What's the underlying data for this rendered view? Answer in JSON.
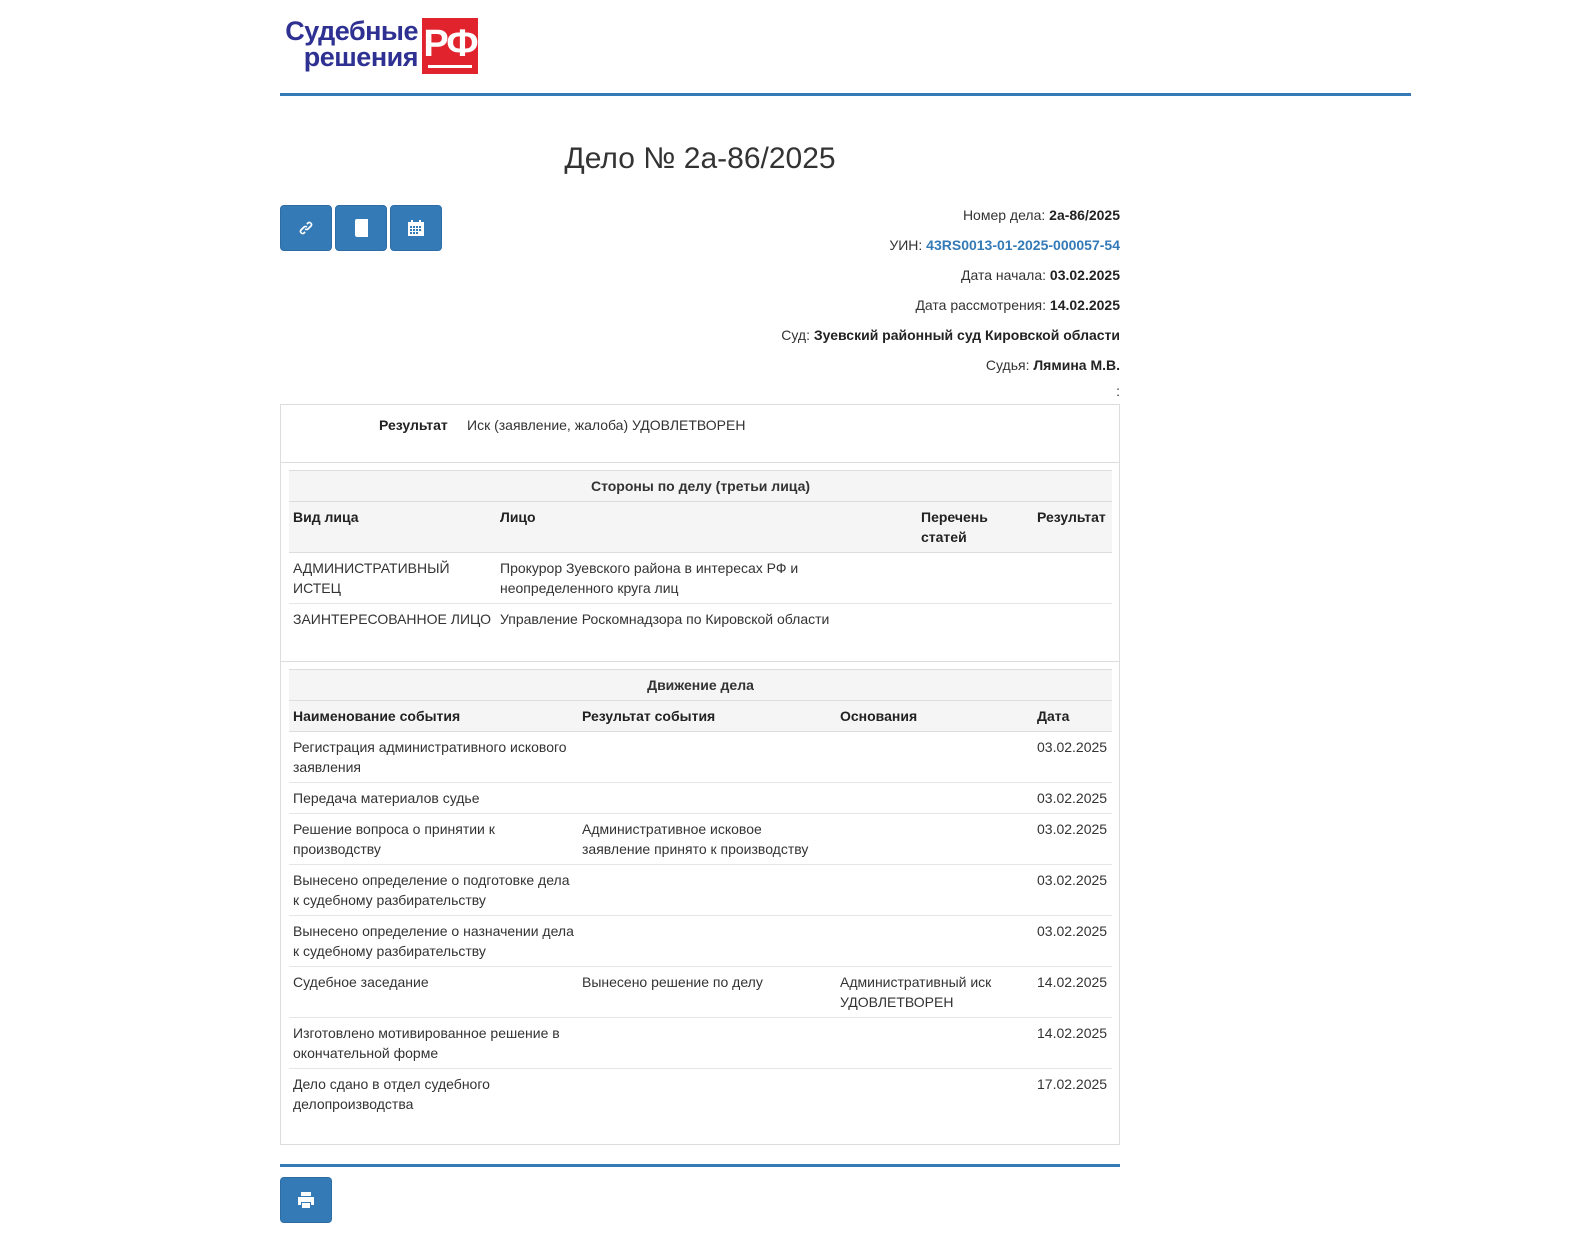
{
  "logo": {
    "line1": "Судебные",
    "line2": "решения",
    "badge": "РФ"
  },
  "title": "Дело № 2а-86/2025",
  "toolbar": {
    "buttons": [
      {
        "icon": "link-icon"
      },
      {
        "icon": "book-icon"
      },
      {
        "icon": "calendar-icon"
      }
    ]
  },
  "info": {
    "case_number_label": "Номер дела:",
    "case_number": "2а-86/2025",
    "uin_label": "УИН:",
    "uin": "43RS0013-01-2025-000057-54",
    "start_date_label": "Дата начала:",
    "start_date": "03.02.2025",
    "review_date_label": "Дата рассмотрения:",
    "review_date": "14.02.2025",
    "court_label": "Суд:",
    "court": "Зуевский районный суд Кировской области",
    "judge_label": "Судья:",
    "judge": "Лямина М.В.",
    "extra": ":"
  },
  "result": {
    "label": "Результат",
    "value": "Иск (заявление, жалоба) УДОВЛЕТВОРЕН"
  },
  "parties": {
    "caption": "Стороны по делу (третьи лица)",
    "headers": [
      "Вид лица",
      "Лицо",
      "Перечень статей",
      "Результат"
    ],
    "rows": [
      [
        "АДМИНИСТРАТИВНЫЙ ИСТЕЦ",
        "Прокурор Зуевского района в интересах РФ и неопределенного круга лиц",
        "",
        ""
      ],
      [
        "ЗАИНТЕРЕСОВАННОЕ ЛИЦО",
        "Управление Роскомнадзора по Кировской области",
        "",
        ""
      ]
    ]
  },
  "movement": {
    "caption": "Движение дела",
    "headers": [
      "Наименование события",
      "Результат события",
      "Основания",
      "Дата"
    ],
    "rows": [
      [
        "Регистрация административного искового заявления",
        "",
        "",
        "03.02.2025"
      ],
      [
        "Передача материалов судье",
        "",
        "",
        "03.02.2025"
      ],
      [
        "Решение вопроса о принятии к производству",
        "Административное исковое заявление принято к производству",
        "",
        "03.02.2025"
      ],
      [
        "Вынесено определение о подготовке дела к судебному разбирательству",
        "",
        "",
        "03.02.2025"
      ],
      [
        "Вынесено определение о назначении дела к судебному разбирательству",
        "",
        "",
        "03.02.2025"
      ],
      [
        "Судебное заседание",
        "Вынесено решение по делу",
        "Административный иск УДОВЛЕТВОРЕН",
        "14.02.2025"
      ],
      [
        "Изготовлено мотивированное решение в окончательной форме",
        "",
        "",
        "14.02.2025"
      ],
      [
        "Дело сдано в отдел судебного делопроизводства",
        "",
        "",
        "17.02.2025"
      ]
    ]
  },
  "footer": {
    "print_icon": "print-icon"
  }
}
